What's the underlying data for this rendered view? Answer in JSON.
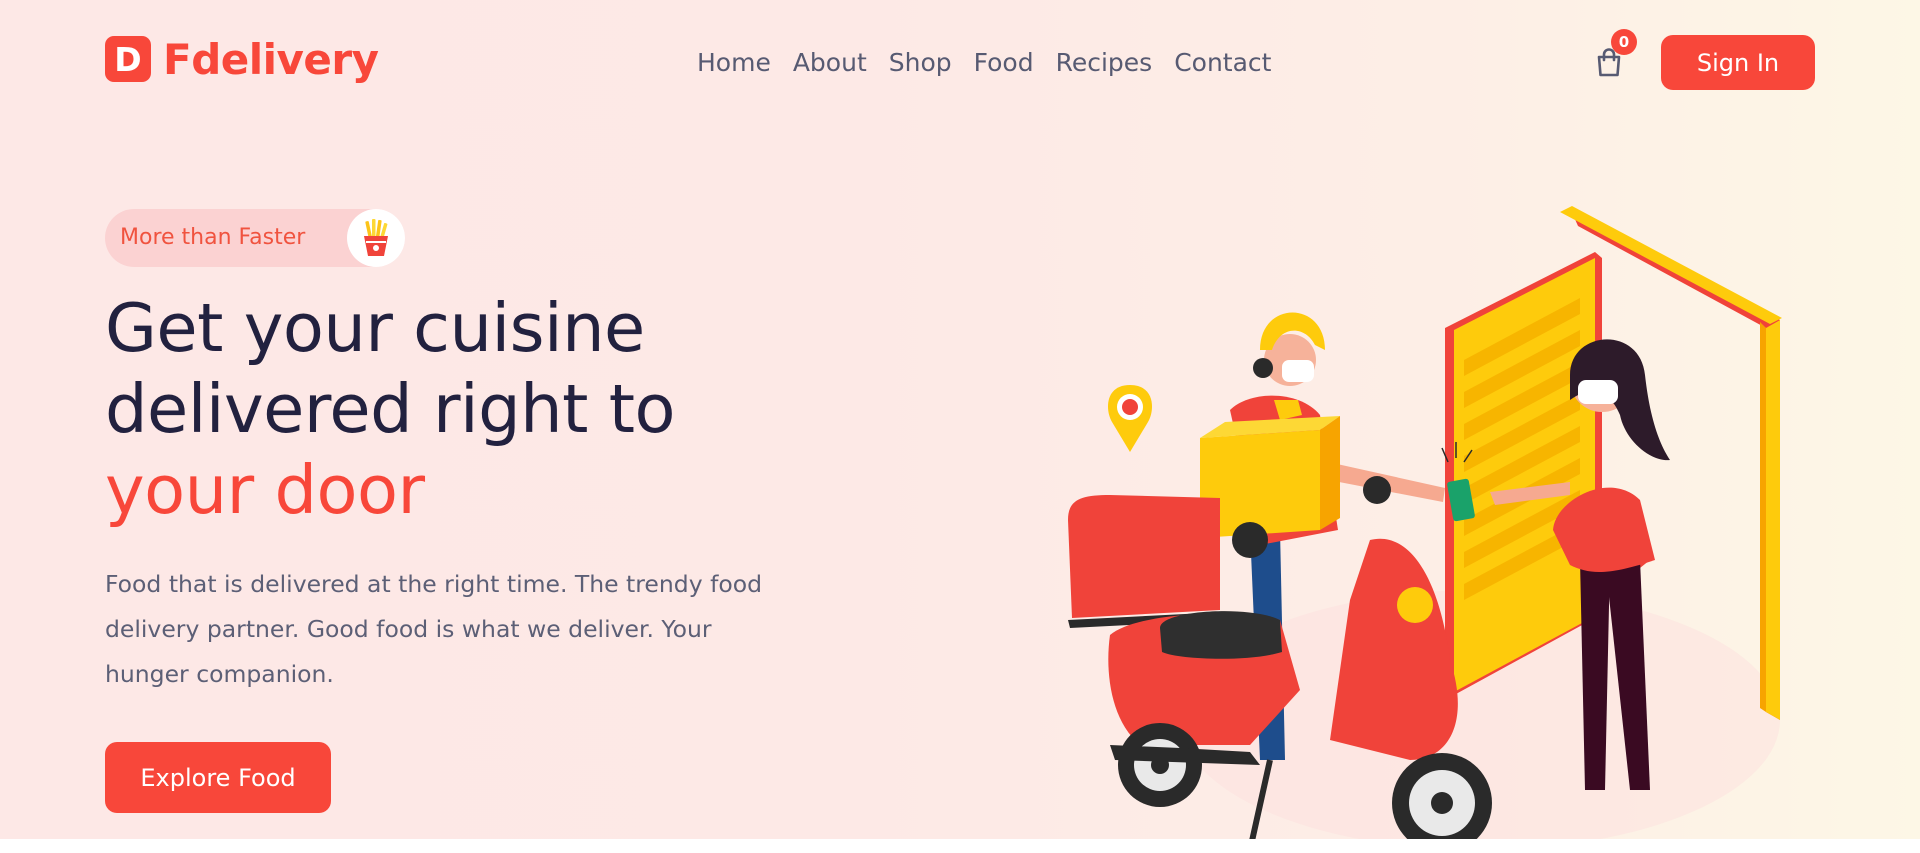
{
  "brand": {
    "mark": "D",
    "name": "Fdelivery",
    "color": "#f8473a"
  },
  "nav": {
    "items": [
      "Home",
      "About",
      "Shop",
      "Food",
      "Recipes",
      "Contact"
    ]
  },
  "cart": {
    "icon": "shopping-bag-icon",
    "count": "0"
  },
  "header": {
    "signin_label": "Sign In"
  },
  "hero": {
    "tag": "More than Faster",
    "tag_icon": "fries-icon",
    "headline_line1": "Get your cuisine",
    "headline_line2": "delivered right to",
    "headline_accent": "your door",
    "description": "Food that is delivered at the right time. The trendy food delivery partner. Good food is what we deliver. Your hunger companion.",
    "cta_label": "Explore Food"
  },
  "colors": {
    "accent": "#f8473a",
    "heading": "#22213f",
    "body_text": "#5c5f76",
    "yellow": "#fecb0c"
  }
}
